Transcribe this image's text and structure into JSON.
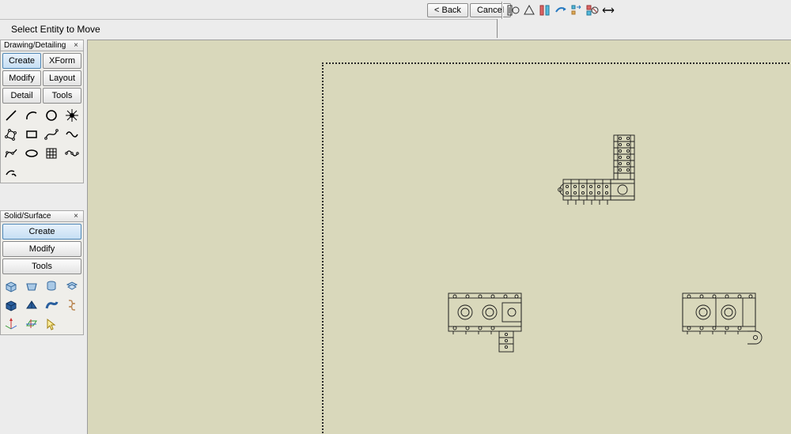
{
  "prompt": "Select Entity to Move",
  "topbar": {
    "back_label": "< Back",
    "cancel_label": "Cancel",
    "icons": [
      "entity-options-icon",
      "triangle-icon",
      "column-toggle-icon",
      "redo-arrow-icon",
      "stretch-icon",
      "options-icon",
      "horizontal-icon"
    ]
  },
  "panels": {
    "drawing": {
      "title": "Drawing/Detailing",
      "tabs": [
        "Create",
        "XForm",
        "Modify",
        "Layout",
        "Detail",
        "Tools"
      ],
      "active_tab": 0,
      "tools": [
        "line",
        "arc",
        "circle",
        "point",
        "polygon",
        "rectangle",
        "bezier",
        "wave",
        "nurbs",
        "ellipse",
        "hatch",
        "spline-edit",
        "cut"
      ]
    },
    "solid": {
      "title": "Solid/Surface",
      "tabs": [
        "Create",
        "Modify",
        "Tools"
      ],
      "active_tab": 0,
      "tools": [
        "extrude",
        "loft",
        "revolve",
        "offset",
        "shell",
        "rib",
        "sweep",
        "helix",
        "axes",
        "plane",
        "pick"
      ]
    }
  }
}
